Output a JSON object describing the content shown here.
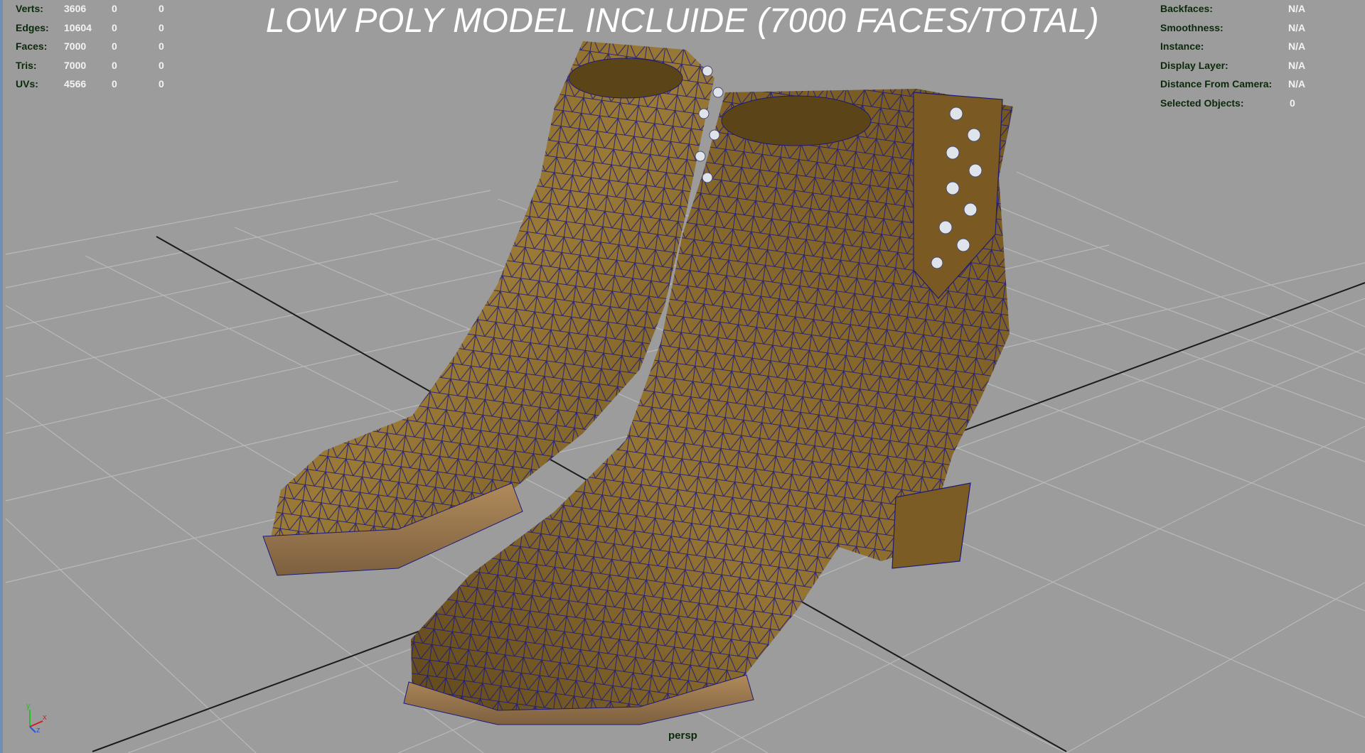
{
  "banner": {
    "title": "LOW POLY MODEL INCLUIDE (7000 FACES/TOTAL)"
  },
  "stats": [
    {
      "label": "Verts:",
      "values": [
        "3606",
        "0",
        "0"
      ]
    },
    {
      "label": "Edges:",
      "values": [
        "10604",
        "0",
        "0"
      ]
    },
    {
      "label": "Faces:",
      "values": [
        "7000",
        "0",
        "0"
      ]
    },
    {
      "label": "Tris:",
      "values": [
        "7000",
        "0",
        "0"
      ]
    },
    {
      "label": "UVs:",
      "values": [
        "4566",
        "0",
        "0"
      ]
    }
  ],
  "object_info": [
    {
      "label": "Backfaces:",
      "value": "N/A"
    },
    {
      "label": "Smoothness:",
      "value": "N/A"
    },
    {
      "label": "Instance:",
      "value": "N/A"
    },
    {
      "label": "Display Layer:",
      "value": "N/A"
    },
    {
      "label": "Distance From Camera:",
      "value": "N/A"
    },
    {
      "label": "Selected Objects:",
      "value": "0"
    }
  ],
  "camera": {
    "name": "persp"
  },
  "axis_indicator": {
    "x": "x",
    "y": "y",
    "z": "z",
    "x_color": "#d22020",
    "y_color": "#22c222",
    "z_color": "#2a56d6"
  },
  "model": {
    "subject": "ankle boots pair",
    "material_color": "#8a6a2a",
    "wire_color": "#1c1a7a"
  },
  "colors": {
    "background": "#9c9c9c",
    "grid": "#b7b7b7",
    "axis_lines": "#1b1b1b",
    "hud_text": "#0b2a0b",
    "banner_text": "#ffffff"
  }
}
